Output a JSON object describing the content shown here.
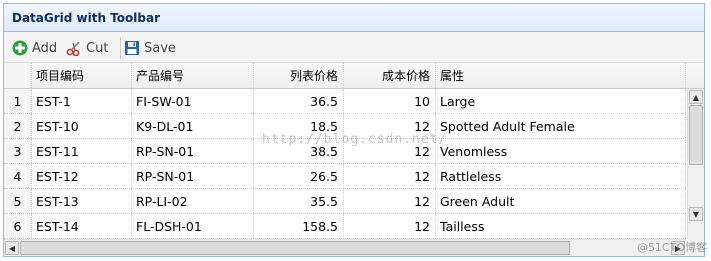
{
  "panel": {
    "title": "DataGrid with Toolbar"
  },
  "toolbar": {
    "add_label": "Add",
    "cut_label": "Cut",
    "save_label": "Save"
  },
  "grid": {
    "columns": [
      "项目编码",
      "产品编号",
      "列表价格",
      "成本价格",
      "属性"
    ],
    "rows": [
      {
        "num": "1",
        "item": "EST-1",
        "product": "FI-SW-01",
        "list": "36.5",
        "cost": "10",
        "attr": "Large"
      },
      {
        "num": "2",
        "item": "EST-10",
        "product": "K9-DL-01",
        "list": "18.5",
        "cost": "12",
        "attr": "Spotted Adult Female"
      },
      {
        "num": "3",
        "item": "EST-11",
        "product": "RP-SN-01",
        "list": "38.5",
        "cost": "12",
        "attr": "Venomless"
      },
      {
        "num": "4",
        "item": "EST-12",
        "product": "RP-SN-01",
        "list": "26.5",
        "cost": "12",
        "attr": "Rattleless"
      },
      {
        "num": "5",
        "item": "EST-13",
        "product": "RP-LI-02",
        "list": "35.5",
        "cost": "12",
        "attr": "Green Adult"
      },
      {
        "num": "6",
        "item": "EST-14",
        "product": "FL-DSH-01",
        "list": "158.5",
        "cost": "12",
        "attr": "Tailless"
      }
    ]
  },
  "watermark": "http://blog.csdn.net/",
  "brand": "@51CTO博客",
  "icons": {
    "add": "plus-circle-icon",
    "cut": "scissors-icon",
    "save": "floppy-disk-icon"
  },
  "colors": {
    "border": "#95b8e7",
    "title": "#0e2d5f",
    "add_green": "#2f9e3a",
    "cut_red": "#c0392b",
    "save_blue": "#2a5fa8"
  }
}
